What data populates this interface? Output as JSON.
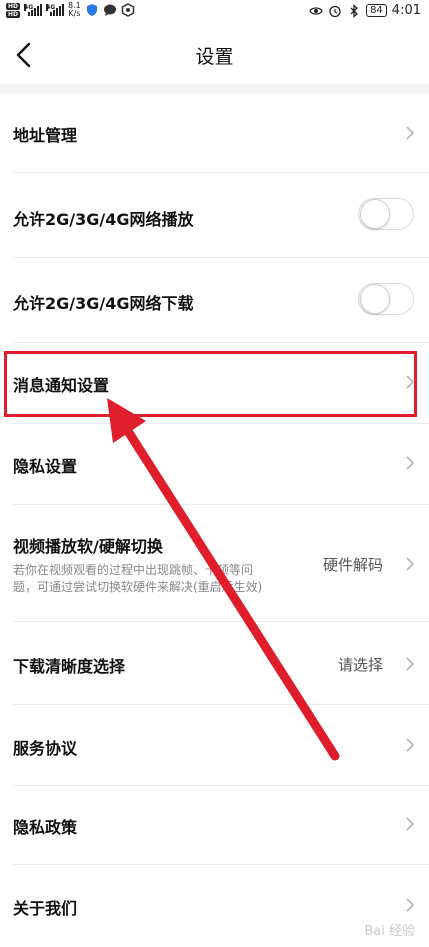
{
  "status_bar": {
    "net1": "4G",
    "net2": "4G",
    "speed_value": "8.1",
    "speed_unit": "K/s",
    "battery": "84",
    "time": "4:01",
    "hd": "HD"
  },
  "header": {
    "title": "设置"
  },
  "rows": [
    {
      "label": "地址管理"
    },
    {
      "label": "允许2G/3G/4G网络播放",
      "toggle_on": false
    },
    {
      "label": "允许2G/3G/4G网络下载",
      "toggle_on": false
    },
    {
      "label": "消息通知设置"
    },
    {
      "label": "隐私设置"
    },
    {
      "label": "视频播放软/硬解切换",
      "desc_line1": "若你在视频观看的过程中出现跳帧、卡顿等问",
      "desc_line2": "题，可通过尝试切换软硬件来解决(重启后生效)",
      "value": "硬件解码"
    },
    {
      "label": "下载清晰度选择",
      "value": "请选择"
    },
    {
      "label": "服务协议"
    },
    {
      "label": "隐私政策"
    },
    {
      "label": "关于我们"
    }
  ],
  "annotation": {
    "highlight_color": "#e01d2a",
    "arrow_color": "#e01d2a"
  },
  "watermark": "Bai 经验"
}
